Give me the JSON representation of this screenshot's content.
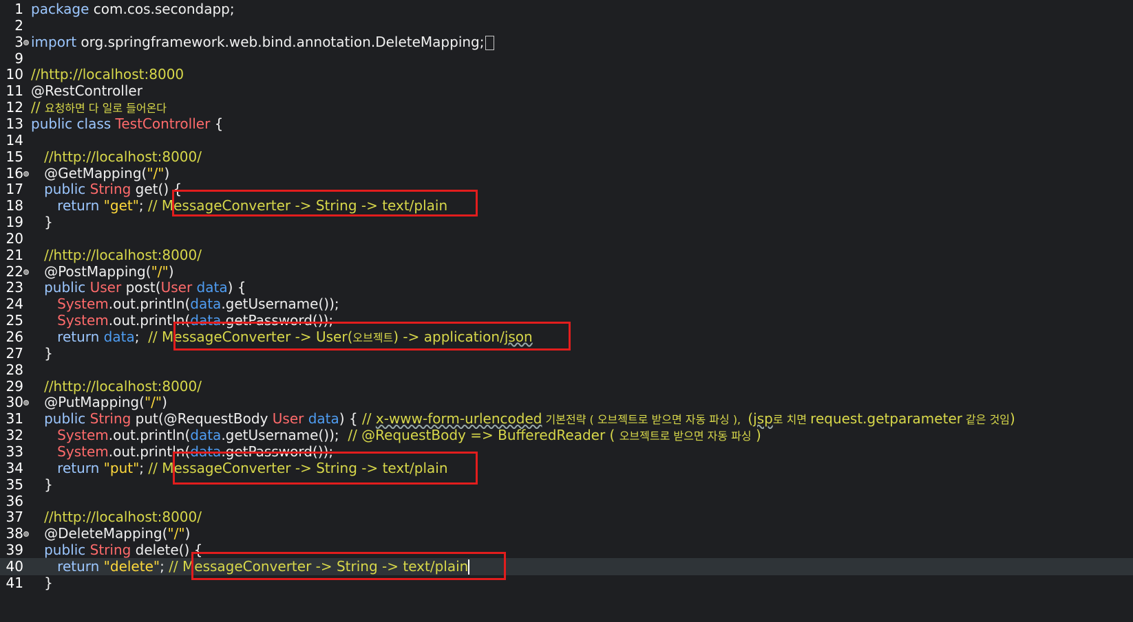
{
  "editor": {
    "lines": [
      {
        "n": "1",
        "parts": [
          [
            "kw",
            "package"
          ],
          [
            "plain",
            " com.cos.secondapp;"
          ]
        ]
      },
      {
        "n": "2",
        "parts": []
      },
      {
        "n": "3",
        "fold": true,
        "parts": [
          [
            "kw",
            "import"
          ],
          [
            "plain",
            " org.springframework.web.bind.annotation.DeleteMapping;"
          ],
          [
            "foldbox",
            ""
          ]
        ]
      },
      {
        "n": "9",
        "parts": []
      },
      {
        "n": "10",
        "parts": [
          [
            "comment",
            "//http://localhost:8000"
          ]
        ]
      },
      {
        "n": "11",
        "parts": [
          [
            "ann",
            "@RestController"
          ]
        ]
      },
      {
        "n": "12",
        "parts": [
          [
            "comment",
            "// "
          ],
          [
            "comment kr",
            "요청하면 다 일로 들어온다"
          ]
        ]
      },
      {
        "n": "13",
        "parts": [
          [
            "kw",
            "public class "
          ],
          [
            "type",
            "TestController"
          ],
          [
            "plain",
            " {"
          ]
        ]
      },
      {
        "n": "14",
        "parts": []
      },
      {
        "n": "15",
        "parts": [
          [
            "plain",
            "   "
          ],
          [
            "comment",
            "//http://localhost:8000/"
          ]
        ]
      },
      {
        "n": "16",
        "fold": true,
        "parts": [
          [
            "plain",
            "   @GetMapping("
          ],
          [
            "str",
            "\"/\""
          ],
          [
            "plain",
            ")"
          ]
        ]
      },
      {
        "n": "17",
        "parts": [
          [
            "plain",
            "   "
          ],
          [
            "kw",
            "public "
          ],
          [
            "type",
            "String"
          ],
          [
            "plain",
            " get() {"
          ]
        ]
      },
      {
        "n": "18",
        "parts": [
          [
            "plain",
            "      "
          ],
          [
            "kw",
            "return "
          ],
          [
            "str",
            "\"get\""
          ],
          [
            "plain",
            "; "
          ],
          [
            "comment",
            "// MessageConverter -> String -> text/plain"
          ]
        ]
      },
      {
        "n": "19",
        "parts": [
          [
            "plain",
            "   }"
          ]
        ]
      },
      {
        "n": "20",
        "parts": []
      },
      {
        "n": "21",
        "parts": [
          [
            "plain",
            "   "
          ],
          [
            "comment",
            "//http://localhost:8000/"
          ]
        ]
      },
      {
        "n": "22",
        "fold": true,
        "parts": [
          [
            "plain",
            "   @PostMapping("
          ],
          [
            "str",
            "\"/\""
          ],
          [
            "plain",
            ")"
          ]
        ]
      },
      {
        "n": "23",
        "parts": [
          [
            "plain",
            "   "
          ],
          [
            "kw",
            "public "
          ],
          [
            "type",
            "User"
          ],
          [
            "plain",
            " post("
          ],
          [
            "type",
            "User"
          ],
          [
            "plain",
            " "
          ],
          [
            "var",
            "data"
          ],
          [
            "plain",
            ") {"
          ]
        ]
      },
      {
        "n": "24",
        "parts": [
          [
            "plain",
            "      "
          ],
          [
            "type",
            "System"
          ],
          [
            "plain",
            ".out.println("
          ],
          [
            "var",
            "data"
          ],
          [
            "plain",
            ".getUsername());"
          ]
        ]
      },
      {
        "n": "25",
        "parts": [
          [
            "plain",
            "      "
          ],
          [
            "type",
            "System"
          ],
          [
            "plain",
            ".out.println("
          ],
          [
            "var",
            "data"
          ],
          [
            "plain",
            ".getPassword());"
          ]
        ]
      },
      {
        "n": "26",
        "parts": [
          [
            "plain",
            "      "
          ],
          [
            "kw",
            "return "
          ],
          [
            "var",
            "data"
          ],
          [
            "plain",
            ";  "
          ],
          [
            "comment",
            "// MessageConverter -> User("
          ],
          [
            "comment kr",
            "오브젝트"
          ],
          [
            "comment",
            ") -> application/"
          ],
          [
            "comment wavy",
            "json"
          ]
        ]
      },
      {
        "n": "27",
        "parts": [
          [
            "plain",
            "   }"
          ]
        ]
      },
      {
        "n": "28",
        "parts": []
      },
      {
        "n": "29",
        "parts": [
          [
            "plain",
            "   "
          ],
          [
            "comment",
            "//http://localhost:8000/"
          ]
        ]
      },
      {
        "n": "30",
        "fold": true,
        "parts": [
          [
            "plain",
            "   @PutMapping("
          ],
          [
            "str",
            "\"/\""
          ],
          [
            "plain",
            ")"
          ]
        ]
      },
      {
        "n": "31",
        "parts": [
          [
            "plain",
            "   "
          ],
          [
            "kw",
            "public "
          ],
          [
            "type",
            "String"
          ],
          [
            "plain",
            " put(@RequestBody "
          ],
          [
            "type",
            "User"
          ],
          [
            "plain",
            " "
          ],
          [
            "var",
            "data"
          ],
          [
            "plain",
            ") { "
          ],
          [
            "comment",
            "// "
          ],
          [
            "comment wavy",
            "x-www-form-urlencoded"
          ],
          [
            "comment kr",
            " 기본전략 ( 오브젝트로 받으면 자동 파싱 ),  "
          ],
          [
            "comment",
            "("
          ],
          [
            "comment wavy",
            "jsp"
          ],
          [
            "comment kr",
            "로 치면 "
          ],
          [
            "comment",
            "request.getparameter"
          ],
          [
            "comment kr",
            " 같은 것임"
          ],
          [
            "comment",
            ")"
          ]
        ]
      },
      {
        "n": "32",
        "parts": [
          [
            "plain",
            "      "
          ],
          [
            "type",
            "System"
          ],
          [
            "plain",
            ".out.println("
          ],
          [
            "var",
            "data"
          ],
          [
            "plain",
            ".getUsername());  "
          ],
          [
            "comment",
            "// @RequestBody => BufferedReader ( "
          ],
          [
            "comment kr",
            "오브젝트로 받으면 자동 파싱"
          ],
          [
            "comment",
            " )"
          ]
        ]
      },
      {
        "n": "33",
        "parts": [
          [
            "plain",
            "      "
          ],
          [
            "type",
            "System"
          ],
          [
            "plain",
            ".out.println("
          ],
          [
            "var",
            "data"
          ],
          [
            "plain",
            ".getPassword());"
          ]
        ]
      },
      {
        "n": "34",
        "parts": [
          [
            "plain",
            "      "
          ],
          [
            "kw",
            "return "
          ],
          [
            "str",
            "\"put\""
          ],
          [
            "plain",
            "; "
          ],
          [
            "comment",
            "// MessageConverter -> String -> text/plain"
          ]
        ]
      },
      {
        "n": "35",
        "parts": [
          [
            "plain",
            "   }"
          ]
        ]
      },
      {
        "n": "36",
        "parts": []
      },
      {
        "n": "37",
        "parts": [
          [
            "plain",
            "   "
          ],
          [
            "comment",
            "//http://localhost:8000/"
          ]
        ]
      },
      {
        "n": "38",
        "fold": true,
        "parts": [
          [
            "plain",
            "   @DeleteMapping("
          ],
          [
            "str",
            "\"/\""
          ],
          [
            "plain",
            ")"
          ]
        ]
      },
      {
        "n": "39",
        "parts": [
          [
            "plain",
            "   "
          ],
          [
            "kw",
            "public "
          ],
          [
            "type",
            "String"
          ],
          [
            "plain",
            " delete() {"
          ]
        ]
      },
      {
        "n": "40",
        "current": true,
        "parts": [
          [
            "plain",
            "      "
          ],
          [
            "kw",
            "return "
          ],
          [
            "str",
            "\"delete\""
          ],
          [
            "plain",
            "; "
          ],
          [
            "comment",
            "// MessageConverter -> String -> text/plain"
          ],
          [
            "cursor",
            ""
          ]
        ]
      },
      {
        "n": "41",
        "parts": [
          [
            "plain",
            "   }"
          ]
        ]
      }
    ],
    "colors": {
      "background": "#1e1f22",
      "keyword": "#9cc7ff",
      "type": "#ff6b6b",
      "variable": "#4f9df2",
      "string": "#ffd93b",
      "comment": "#d8d84a",
      "highlight_box": "#e21d1d"
    }
  }
}
